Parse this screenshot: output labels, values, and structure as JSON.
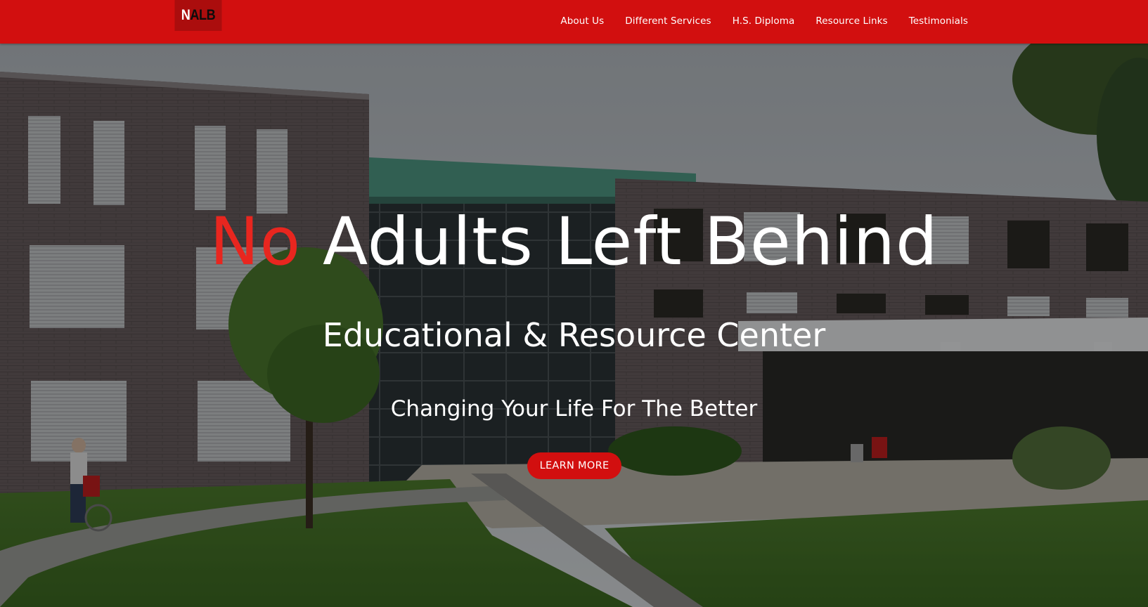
{
  "header": {
    "logo": {
      "first_letter": "N",
      "rest": "ALB"
    },
    "nav": [
      {
        "label": "About Us"
      },
      {
        "label": "Different Services"
      },
      {
        "label": "H.S. Diploma"
      },
      {
        "label": "Resource Links"
      },
      {
        "label": "Testimonials"
      }
    ]
  },
  "hero": {
    "title_accent": "No",
    "title_rest": "Adults Left Behind",
    "subtitle": "Educational & Resource Center",
    "tagline": "Changing Your Life For The Better",
    "cta_label": "LEARN MORE"
  },
  "colors": {
    "brand_red": "#d20f0f",
    "accent_red": "#e8261f",
    "text": "#ffffff"
  }
}
